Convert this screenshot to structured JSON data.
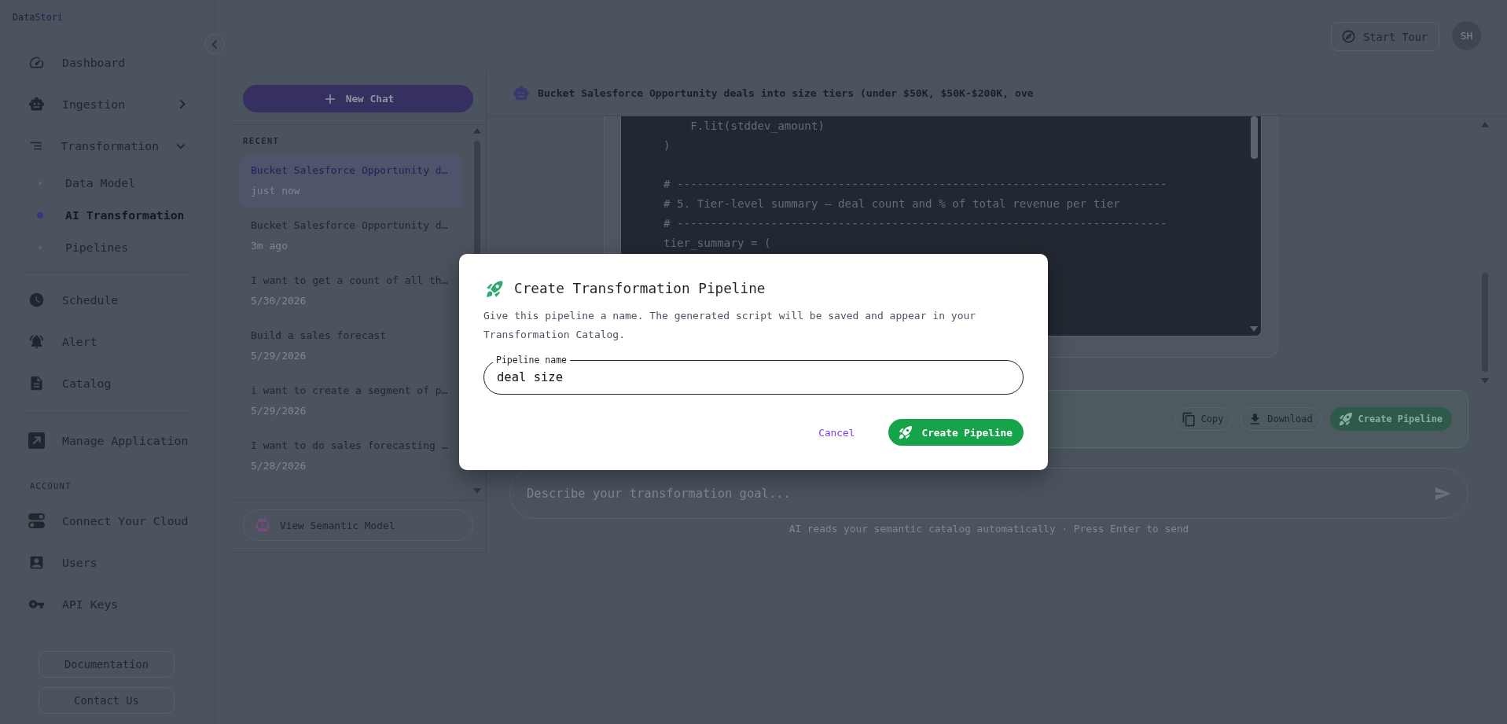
{
  "brand": {
    "name_start": "Data",
    "name_end": "Stori"
  },
  "sidebar": {
    "sections": [
      {
        "items": [
          {
            "label": "Dashboard",
            "selected": false
          },
          {
            "label": "Ingestion",
            "selected": false,
            "expanded": false
          },
          {
            "label": "Transformation",
            "selected": false,
            "expanded": true,
            "children": [
              {
                "label": "Data Model",
                "selected": false
              },
              {
                "label": "AI Transformation",
                "selected": true
              },
              {
                "label": "Pipelines",
                "selected": false
              }
            ]
          }
        ]
      },
      {
        "items": [
          {
            "label": "Schedule",
            "selected": false
          },
          {
            "label": "Alert",
            "selected": false
          },
          {
            "label": "Catalog",
            "selected": false
          }
        ]
      },
      {
        "items": [
          {
            "label": "Manage Application",
            "selected": false
          }
        ]
      },
      {
        "heading": "ACCOUNT",
        "items": [
          {
            "label": "Connect Your Cloud",
            "selected": false
          },
          {
            "label": "Users",
            "selected": false
          },
          {
            "label": "API Keys",
            "selected": false
          }
        ]
      }
    ],
    "links": [
      "Documentation",
      "Contact Us"
    ]
  },
  "topbar": {
    "tour_button": "Start Tour",
    "avatar": "SH"
  },
  "chat_panel": {
    "new_chat_button": "New Chat",
    "section_label": "RECENT",
    "chats": [
      {
        "title": "Bucket Salesforce Opportunity d…",
        "time": "just now",
        "selected": true
      },
      {
        "title": "Bucket Salesforce Opportunity d…",
        "time": "3m ago",
        "selected": false
      },
      {
        "title": "I want to get a count of all th…",
        "time": "5/30/2026",
        "selected": false
      },
      {
        "title": "Build a sales forecast",
        "time": "5/29/2026",
        "selected": false
      },
      {
        "title": "i want to create a segment of p…",
        "time": "5/29/2026",
        "selected": false
      },
      {
        "title": "I want to do sales forecasting …",
        "time": "5/28/2026",
        "selected": false
      }
    ],
    "semantic_model_button": "View Semantic Model"
  },
  "conversation": {
    "title": "Bucket Salesforce Opportunity deals into size tiers (under $50K, $50K-$200K, ove",
    "code": "    F.lit(stddev_amount)\n)\n\n# -------------------------------------------------------------------------\n# 5. Tier-level summary — deal count and % of total revenue per tier\n# -------------------------------------------------------------------------\ntier_summary = (",
    "actions": [
      {
        "label": "Copy",
        "kind": "outline"
      },
      {
        "label": "Download",
        "kind": "outline"
      },
      {
        "label": "Create Pipeline",
        "kind": "primary"
      }
    ],
    "composer": {
      "placeholder": "Describe your transformation goal...",
      "hint": "AI reads your semantic catalog automatically · Press Enter to send"
    }
  },
  "dialog": {
    "title": "Create Transformation Pipeline",
    "description": "Give this pipeline a name. The generated script will be saved and appear in your Transformation Catalog.",
    "field": {
      "label": "Pipeline name",
      "value": "deal size"
    },
    "buttons": [
      {
        "label": "Cancel",
        "kind": "text"
      },
      {
        "label": "Create Pipeline",
        "kind": "primary"
      }
    ]
  }
}
